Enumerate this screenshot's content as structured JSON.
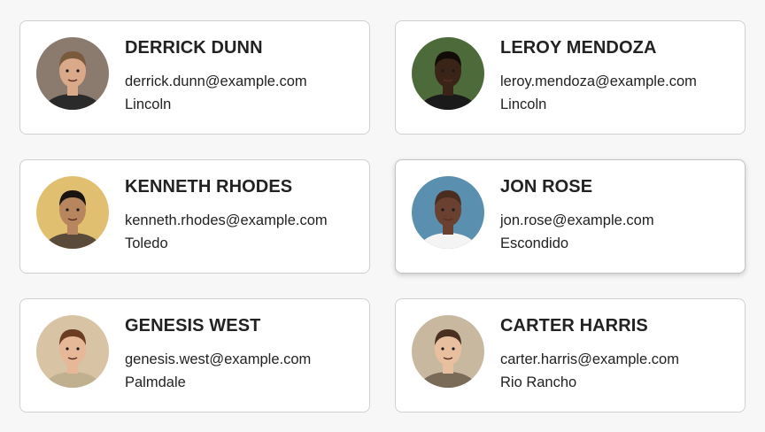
{
  "contacts": [
    {
      "name": "DERRICK DUNN",
      "email": "derrick.dunn@example.com",
      "city": "Lincoln",
      "avatar_colors": {
        "bg": "#8b7a6e",
        "skin": "#d9a98a",
        "hair": "#7a5a3c",
        "shirt": "#2a2a2a"
      }
    },
    {
      "name": "LEROY MENDOZA",
      "email": "leroy.mendoza@example.com",
      "city": "Lincoln",
      "avatar_colors": {
        "bg": "#4d6b3a",
        "skin": "#3a2418",
        "hair": "#120c08",
        "shirt": "#1a1a1a"
      }
    },
    {
      "name": "KENNETH RHODES",
      "email": "kenneth.rhodes@example.com",
      "city": "Toledo",
      "avatar_colors": {
        "bg": "#e0c070",
        "skin": "#b8865e",
        "hair": "#1a1410",
        "shirt": "#5a4a3a"
      }
    },
    {
      "name": "JON ROSE",
      "email": "jon.rose@example.com",
      "city": "Escondido",
      "avatar_colors": {
        "bg": "#5a8fb0",
        "skin": "#6a4030",
        "hair": "#4a2c20",
        "shirt": "#f4f4f4"
      }
    },
    {
      "name": "GENESIS WEST",
      "email": "genesis.west@example.com",
      "city": "Palmdale",
      "avatar_colors": {
        "bg": "#d8c4a4",
        "skin": "#e6b898",
        "hair": "#6a3c22",
        "shirt": "#c0b090"
      }
    },
    {
      "name": "CARTER HARRIS",
      "email": "carter.harris@example.com",
      "city": "Rio Rancho",
      "avatar_colors": {
        "bg": "#c8b8a0",
        "skin": "#e8c0a0",
        "hair": "#4a3020",
        "shirt": "#7a6a58"
      }
    }
  ]
}
